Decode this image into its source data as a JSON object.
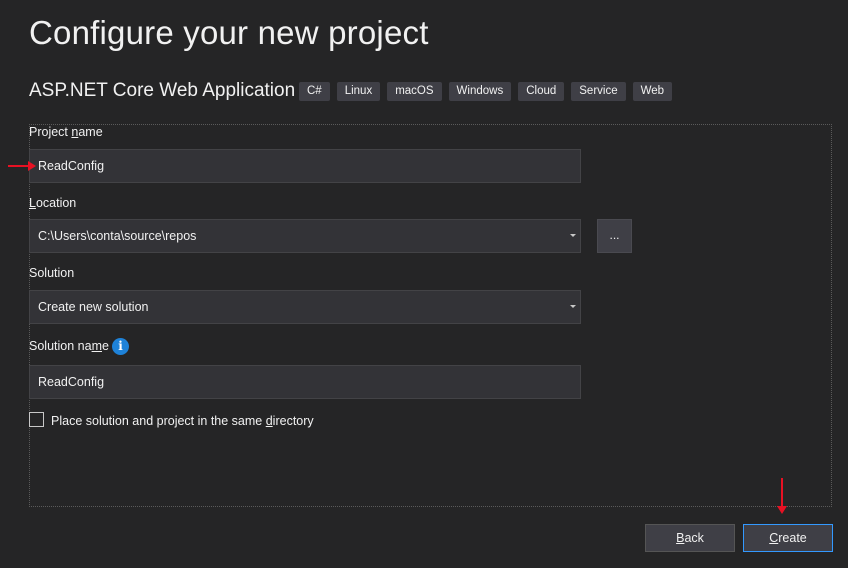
{
  "header": {
    "title": "Configure your new project",
    "template_name": "ASP.NET Core Web Application",
    "tags": [
      "C#",
      "Linux",
      "macOS",
      "Windows",
      "Cloud",
      "Service",
      "Web"
    ]
  },
  "form": {
    "project_name": {
      "label_pre": "Project ",
      "label_accel": "n",
      "label_post": "ame",
      "value": "ReadConfig"
    },
    "location": {
      "label_pre": "",
      "label_accel": "L",
      "label_post": "ocation",
      "value": "C:\\Users\\conta\\source\\repos",
      "browse_label": "..."
    },
    "solution": {
      "label": "Solution",
      "value": "Create new solution"
    },
    "solution_name": {
      "label_pre": "Solution na",
      "label_accel": "m",
      "label_post": "e",
      "value": "ReadConfig",
      "info_icon": "i"
    },
    "same_directory": {
      "label_pre": "Place solution and project in the same ",
      "label_accel": "d",
      "label_post": "irectory",
      "checked": false
    }
  },
  "buttons": {
    "back": {
      "accel": "B",
      "rest": "ack"
    },
    "create": {
      "accel": "C",
      "rest": "reate"
    }
  },
  "colors": {
    "background": "#252526",
    "field": "#333337",
    "accent": "#3399ff",
    "annotation_arrow": "#e81123",
    "info": "#1e82d8"
  }
}
